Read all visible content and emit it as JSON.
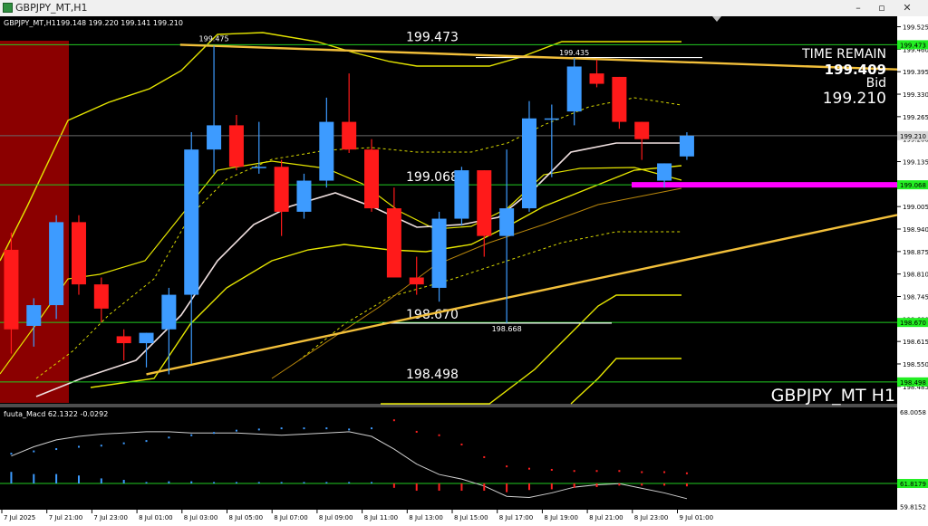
{
  "window": {
    "title": "GBPJPY_MT,H1",
    "minimize": "–",
    "restore": "▫",
    "close": "✕"
  },
  "chart_data": {
    "type": "candlestick",
    "symbol_header": "GBPJPY_MT,H1",
    "ohlc_header": "199.148 199.220 199.141 199.210",
    "watermark": "GBPJPY_MT H1",
    "info_panel": {
      "label": "TIME REMAIN",
      "price_overlap": "199.409",
      "bid_label": "Bid",
      "bid_value": "199.210"
    },
    "ylim": [
      198.44,
      199.55
    ],
    "y_ticks": [
      "199.525",
      "199.460",
      "199.395",
      "199.330",
      "199.265",
      "199.200",
      "199.135",
      "199.070",
      "199.005",
      "198.940",
      "198.875",
      "198.810",
      "198.745",
      "198.680",
      "198.615",
      "198.550",
      "198.485"
    ],
    "y_tags": [
      {
        "label": "199.473",
        "value": 199.473,
        "color": "#22ee22"
      },
      {
        "label": "199.210",
        "value": 199.21,
        "color": "#d8d8d8"
      },
      {
        "label": "199.068",
        "value": 199.068,
        "color": "#22ee22"
      },
      {
        "label": "198.670",
        "value": 198.67,
        "color": "#22ee22"
      },
      {
        "label": "198.498",
        "value": 198.498,
        "color": "#22ee22"
      }
    ],
    "x_labels": [
      "7 Jul 2025",
      "7 Jul 21:00",
      "7 Jul 23:00",
      "8 Jul 01:00",
      "8 Jul 03:00",
      "8 Jul 05:00",
      "8 Jul 07:00",
      "8 Jul 09:00",
      "8 Jul 11:00",
      "8 Jul 13:00",
      "8 Jul 15:00",
      "8 Jul 17:00",
      "8 Jul 19:00",
      "8 Jul 21:00",
      "8 Jul 23:00",
      "9 Jul 01:00"
    ],
    "levels": [
      {
        "label": "199.473",
        "value": 199.473
      },
      {
        "label": "199.068",
        "value": 199.068
      },
      {
        "label": "198.670",
        "value": 198.67
      },
      {
        "label": "198.498",
        "value": 198.498
      }
    ],
    "point_labels": [
      {
        "label": "199.475",
        "value": 199.475,
        "bar": 9
      },
      {
        "label": "199.435",
        "value": 199.435,
        "bar": 25
      },
      {
        "label": "198.668",
        "value": 198.668,
        "bar": 22
      }
    ],
    "candles": [
      {
        "o": 198.88,
        "h": 198.93,
        "l": 198.58,
        "c": 198.65
      },
      {
        "o": 198.66,
        "h": 198.74,
        "l": 198.6,
        "c": 198.72
      },
      {
        "o": 198.72,
        "h": 198.98,
        "l": 198.68,
        "c": 198.96
      },
      {
        "o": 198.96,
        "h": 198.98,
        "l": 198.75,
        "c": 198.78
      },
      {
        "o": 198.78,
        "h": 198.8,
        "l": 198.67,
        "c": 198.71
      },
      {
        "o": 198.63,
        "h": 198.65,
        "l": 198.56,
        "c": 198.61
      },
      {
        "o": 198.61,
        "h": 198.64,
        "l": 198.54,
        "c": 198.64
      },
      {
        "o": 198.65,
        "h": 198.77,
        "l": 198.52,
        "c": 198.75
      },
      {
        "o": 198.75,
        "h": 199.22,
        "l": 198.55,
        "c": 199.17
      },
      {
        "o": 199.17,
        "h": 199.47,
        "l": 199.1,
        "c": 199.24
      },
      {
        "o": 199.24,
        "h": 199.27,
        "l": 199.11,
        "c": 199.12
      },
      {
        "o": 199.12,
        "h": 199.25,
        "l": 199.1,
        "c": 199.12
      },
      {
        "o": 199.12,
        "h": 199.14,
        "l": 198.92,
        "c": 198.99
      },
      {
        "o": 198.99,
        "h": 199.1,
        "l": 198.97,
        "c": 199.08
      },
      {
        "o": 199.08,
        "h": 199.32,
        "l": 199.06,
        "c": 199.25
      },
      {
        "o": 199.25,
        "h": 199.39,
        "l": 199.16,
        "c": 199.17
      },
      {
        "o": 199.17,
        "h": 199.2,
        "l": 198.99,
        "c": 199.0
      },
      {
        "o": 199.0,
        "h": 199.06,
        "l": 198.8,
        "c": 198.8
      },
      {
        "o": 198.8,
        "h": 198.86,
        "l": 198.75,
        "c": 198.78
      },
      {
        "o": 198.77,
        "h": 198.99,
        "l": 198.73,
        "c": 198.97
      },
      {
        "o": 198.97,
        "h": 199.12,
        "l": 198.95,
        "c": 199.11
      },
      {
        "o": 199.11,
        "h": 199.11,
        "l": 198.86,
        "c": 198.92
      },
      {
        "o": 198.92,
        "h": 199.17,
        "l": 198.668,
        "c": 199.0
      },
      {
        "o": 199.0,
        "h": 199.31,
        "l": 198.99,
        "c": 199.26
      },
      {
        "o": 199.26,
        "h": 199.3,
        "l": 199.09,
        "c": 199.26
      },
      {
        "o": 199.28,
        "h": 199.435,
        "l": 199.24,
        "c": 199.41
      },
      {
        "o": 199.39,
        "h": 199.43,
        "l": 199.35,
        "c": 199.36
      },
      {
        "o": 199.38,
        "h": 199.38,
        "l": 199.23,
        "c": 199.25
      },
      {
        "o": 199.25,
        "h": 199.25,
        "l": 199.14,
        "c": 199.2
      },
      {
        "o": 199.08,
        "h": 199.13,
        "l": 199.06,
        "c": 199.13
      },
      {
        "o": 199.15,
        "h": 199.22,
        "l": 199.14,
        "c": 199.21
      }
    ],
    "trendlines": [
      {
        "name": "upper",
        "from": {
          "bar": 7.5,
          "value": 199.473
        },
        "to": {
          "bar": 40,
          "value": 199.4
        }
      },
      {
        "name": "lower",
        "from": {
          "bar": 6,
          "value": 198.52
        },
        "to": {
          "bar": 40,
          "value": 198.99
        }
      }
    ],
    "macd": {
      "label": "fuuta_Macd 62.1322 -0.0292",
      "ylim": [
        59.7,
        68.1
      ],
      "y_ticks": [
        "68.0058",
        "61.8179",
        "59.8152"
      ],
      "signal_level": 61.8179,
      "line": [
        64.2,
        65.0,
        65.6,
        65.9,
        66.1,
        66.2,
        66.3,
        66.3,
        66.2,
        66.2,
        66.2,
        66.1,
        66.0,
        66.1,
        66.2,
        66.3,
        65.9,
        64.8,
        63.5,
        62.6,
        62.2,
        61.6,
        60.7,
        60.6,
        61.0,
        61.5,
        61.7,
        61.8,
        61.4,
        61.0,
        60.5
      ],
      "dots": [
        64.4,
        64.6,
        64.8,
        65.0,
        65.1,
        65.3,
        65.5,
        65.8,
        66.0,
        66.2,
        66.4,
        66.5,
        66.6,
        66.6,
        66.6,
        66.5,
        66.6,
        67.3,
        66.3,
        66.0,
        65.2,
        64.1,
        63.3,
        63.1,
        63.0,
        62.9,
        62.9,
        62.9,
        62.8,
        62.8,
        62.7
      ],
      "histogram": [
        1.6,
        1.3,
        1.3,
        1.1,
        0.7,
        0.5,
        0.2,
        0.3,
        0.3,
        0.2,
        0.2,
        0.2,
        0.2,
        0.2,
        0.2,
        0.2,
        0.2,
        -0.6,
        -1.0,
        -1.0,
        -1.0,
        -1.0,
        -1.2,
        -0.9,
        -0.8,
        -0.6,
        -0.5,
        -0.3,
        -0.3,
        -0.3,
        -0.4
      ]
    }
  }
}
